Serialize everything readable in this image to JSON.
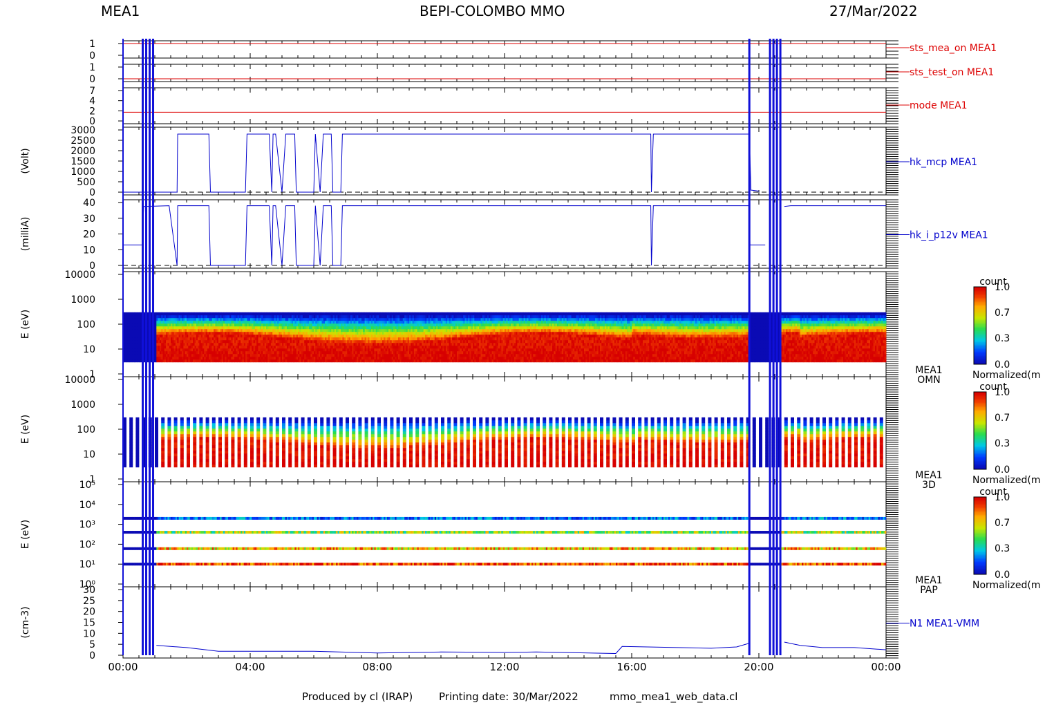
{
  "header": {
    "instrument": "MEA1",
    "mission": "BEPI-COLOMBO MMO",
    "date": "27/Mar/2022"
  },
  "footer": {
    "produced_by": "Produced by cl (IRAP)",
    "printing_date": "Printing date: 30/Mar/2022",
    "script": "mmo_mea1_web_data.cl"
  },
  "colors": {
    "status_line": "#dd0000",
    "data_line": "#0000cc",
    "axis": "#000000",
    "gap_band": "#1010d8"
  },
  "chart_data": [
    {
      "type": "line",
      "label": "sts_mea_on MEA1",
      "yticks": [
        "1",
        "0"
      ],
      "ylim": [
        0,
        1
      ],
      "segments": [
        {
          "x": [
            0,
            24
          ],
          "y": [
            1,
            1
          ]
        }
      ]
    },
    {
      "type": "line",
      "label": "sts_test_on MEA1",
      "yticks": [
        "1",
        "0"
      ],
      "ylim": [
        0,
        1
      ],
      "segments": [
        {
          "x": [
            0,
            24
          ],
          "y": [
            0,
            0
          ]
        }
      ]
    },
    {
      "type": "line",
      "label": "mode MEA1",
      "yticks": [
        "7",
        "4",
        "2",
        "0"
      ],
      "ylim": [
        0,
        7
      ],
      "segments": [
        {
          "x": [
            0,
            24
          ],
          "y": [
            2,
            2
          ]
        }
      ]
    },
    {
      "type": "line",
      "label": "hk_mcp MEA1",
      "ylabel": "(Volt)",
      "yticks": [
        "3000",
        "2500",
        "2000",
        "1500",
        "1000",
        "500",
        "0"
      ],
      "ylim": [
        0,
        3000
      ],
      "segments": [
        {
          "x": [
            0.0,
            0.05,
            1.45,
            1.7,
            1.72,
            2.7,
            2.75,
            3.85,
            3.9,
            4.6,
            4.68,
            4.72,
            4.8,
            5.0,
            5.12,
            5.4,
            5.45,
            6.0,
            6.05,
            6.2,
            6.3,
            6.55,
            6.6,
            6.85,
            6.9,
            16.6,
            16.62,
            16.68,
            16.7,
            19.7,
            19.75,
            20.0
          ],
          "y": [
            0,
            0,
            0,
            0,
            2800,
            2800,
            0,
            0,
            2800,
            2800,
            0,
            2800,
            2800,
            0,
            2800,
            2800,
            0,
            0,
            2800,
            0,
            2800,
            2800,
            0,
            0,
            2800,
            2800,
            0,
            2800,
            2800,
            2800,
            100,
            50
          ]
        }
      ]
    },
    {
      "type": "line",
      "label": "hk_i_p12v MEA1",
      "ylabel": "(milliA)",
      "yticks": [
        "40",
        "30",
        "20",
        "10",
        "0"
      ],
      "ylim": [
        0,
        40
      ],
      "segments": [
        {
          "x": [
            0.0,
            0.6,
            0.65,
            1.45,
            1.7,
            1.72,
            2.7,
            2.75,
            3.85,
            3.9,
            4.6,
            4.68,
            4.72,
            4.8,
            5.0,
            5.12,
            5.4,
            5.45,
            6.0,
            6.05,
            6.2,
            6.3,
            6.55,
            6.6,
            6.85,
            6.9,
            16.6,
            16.62,
            16.68,
            16.7,
            19.7,
            19.72,
            20.2
          ],
          "y": [
            13,
            13,
            37.5,
            38,
            0,
            38,
            38,
            0,
            0,
            38,
            38,
            0,
            38,
            38,
            0,
            38,
            38,
            0,
            0,
            38,
            0,
            38,
            38,
            0,
            0,
            38,
            38,
            0,
            38,
            38,
            38,
            13,
            13
          ]
        },
        {
          "x": [
            20.8,
            21.0,
            24.0
          ],
          "y": [
            37.5,
            38,
            38
          ]
        }
      ]
    },
    {
      "type": "heatmap",
      "label": "MEA1 OMN",
      "ylabel": "E (eV)",
      "yticks": [
        "10000",
        "1000",
        "100",
        "10",
        "1"
      ],
      "ylog": true,
      "ylim": [
        1,
        10000
      ],
      "energy_range": [
        3,
        300
      ],
      "colorbar": {
        "title": "count",
        "ticks": [
          "1.0",
          "0.7",
          "0.3",
          "0.0"
        ],
        "caption": "Normalized(m"
      }
    },
    {
      "type": "heatmap",
      "label": "MEA1 3D",
      "ylabel": "E (eV)",
      "yticks": [
        "10000",
        "1000",
        "100",
        "10",
        "1"
      ],
      "ylog": true,
      "ylim": [
        1,
        10000
      ],
      "energy_range": [
        3,
        300
      ],
      "colorbar": {
        "title": "count",
        "ticks": [
          "1.0",
          "0.7",
          "0.3",
          "0.0"
        ],
        "caption": "Normalized(m"
      }
    },
    {
      "type": "heatmap",
      "label": "MEA1 PAP",
      "ylabel": "E (eV)",
      "yticks": [
        "10⁵",
        "10⁴",
        "10³",
        "10²",
        "10¹",
        "10⁰"
      ],
      "ylog": true,
      "ylim": [
        1,
        100000
      ],
      "bands_eV": [
        2000,
        400,
        60,
        10
      ],
      "colorbar": {
        "title": "count",
        "ticks": [
          "1.0",
          "0.7",
          "0.3",
          "0.0"
        ],
        "caption": "Normalized(m"
      }
    },
    {
      "type": "line",
      "label": "N1 MEA1-VMM",
      "ylabel": "(cm-3)",
      "yticks": [
        "30",
        "25",
        "20",
        "15",
        "10",
        "5",
        "0"
      ],
      "ylim": [
        0,
        30
      ],
      "segments": [
        {
          "x": [
            1.05,
            2.0,
            3.0,
            4.0,
            6.0,
            8.0,
            10.0,
            12.0,
            13.0,
            15.5,
            15.7,
            16.5,
            18.5,
            19.3,
            19.7
          ],
          "y": [
            4.5,
            3.5,
            1.8,
            1.8,
            1.8,
            1.0,
            1.5,
            1.3,
            1.5,
            0.8,
            4.0,
            3.8,
            3.2,
            3.8,
            5.5
          ]
        },
        {
          "x": [
            20.8,
            21.3,
            22.0,
            23.0,
            24.0
          ],
          "y": [
            6.0,
            4.5,
            3.5,
            3.5,
            2.5
          ]
        }
      ]
    }
  ],
  "time_axis": {
    "range_hours": [
      0,
      24
    ],
    "tick_labels": [
      "00:00",
      "04:00",
      "08:00",
      "12:00",
      "16:00",
      "20:00",
      "00:00"
    ],
    "gap_intervals_hours": [
      [
        0.62,
        1.05
      ],
      [
        19.7,
        19.75
      ],
      [
        20.35,
        20.7
      ]
    ]
  }
}
